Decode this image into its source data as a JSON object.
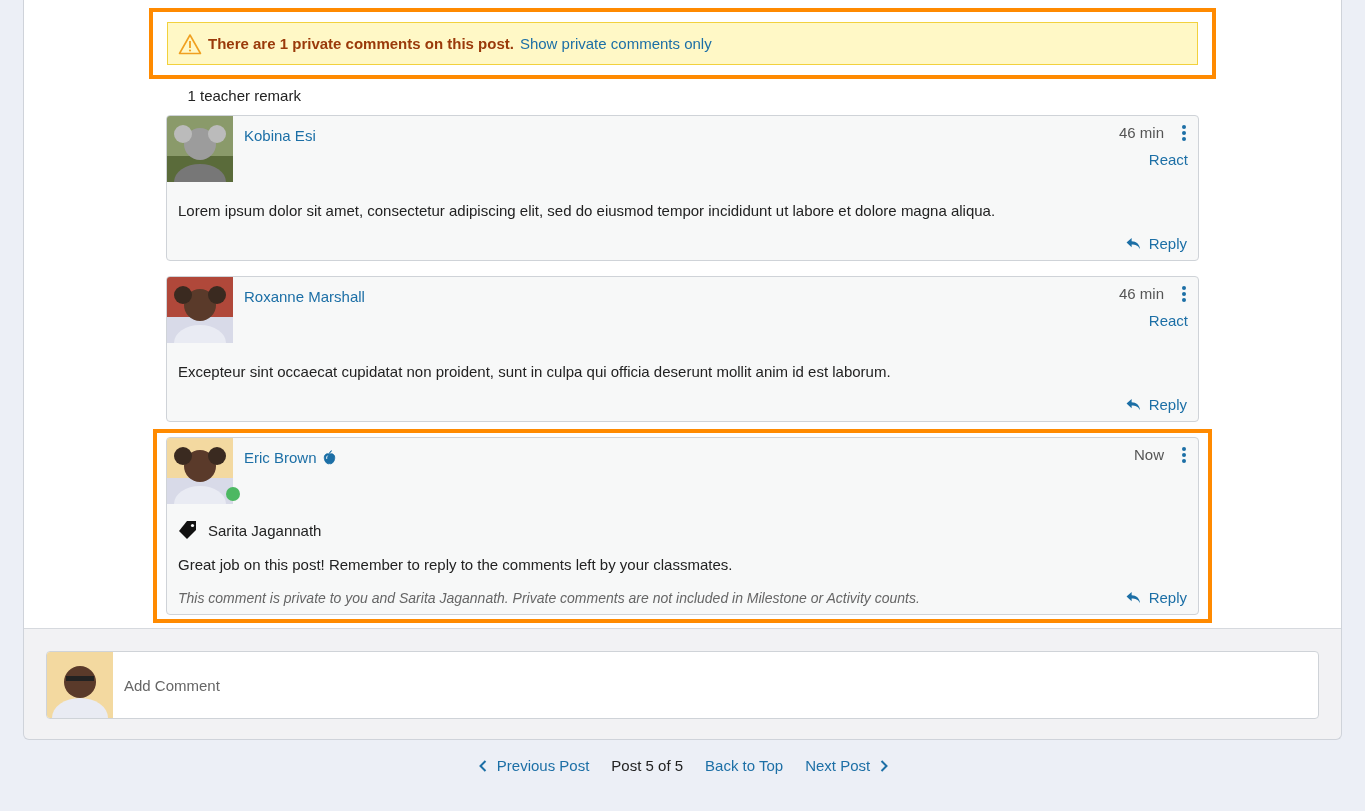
{
  "alert": {
    "highlighted": true,
    "message": "There are 1 private comments on this post.",
    "link": "Show private comments only"
  },
  "remark_count": "1 teacher remark",
  "comments": [
    {
      "author": "Kobina Esi",
      "teacher": false,
      "online": false,
      "time": "46 min",
      "react": "React",
      "body": "Lorem ipsum dolor sit amet, consectetur adipiscing elit, sed do eiusmod tempor incididunt ut labore et dolore magna aliqua.",
      "reply": "Reply",
      "highlighted": false
    },
    {
      "author": "Roxanne Marshall",
      "teacher": false,
      "online": false,
      "time": "46 min",
      "react": "React",
      "body": "Excepteur sint occaecat cupidatat non proident, sunt in culpa qui officia deserunt mollit anim id est laborum.",
      "reply": "Reply",
      "highlighted": false
    },
    {
      "author": "Eric Brown",
      "teacher": true,
      "online": true,
      "time": "Now",
      "tag": "Sarita Jagannath",
      "body": "Great job on this post! Remember to reply to the comments left by your classmates.",
      "private_note": "This comment is private to you and Sarita Jagannath. Private comments are not included in Milestone or Activity counts.",
      "reply": "Reply",
      "highlighted": true
    }
  ],
  "composer": {
    "placeholder": "Add Comment"
  },
  "pager": {
    "previous": "Previous Post",
    "position": "Post 5 of 5",
    "top": "Back to Top",
    "next": "Next Post"
  }
}
